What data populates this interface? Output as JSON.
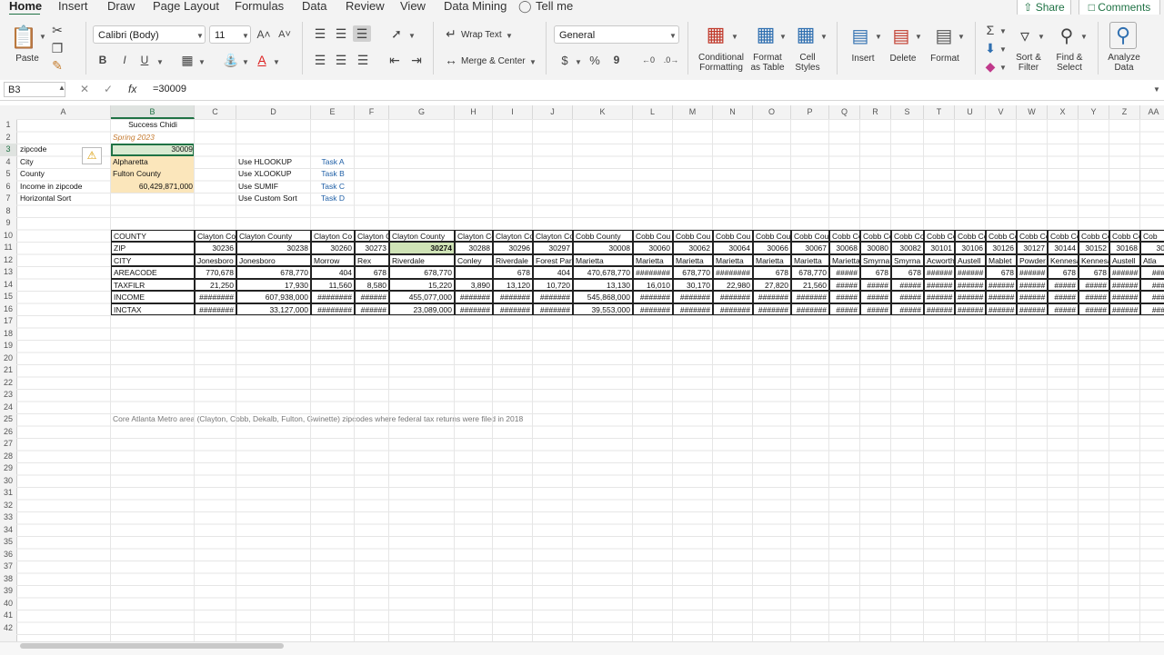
{
  "tabs": [
    "Home",
    "Insert",
    "Draw",
    "Page Layout",
    "Formulas",
    "Data",
    "Review",
    "View",
    "Data Mining",
    "Tell me"
  ],
  "share_label": "Share",
  "comments_label": "Comments",
  "ribbon": {
    "paste": "Paste",
    "font_name": "Calibri (Body)",
    "font_size": "11",
    "bold": "B",
    "italic": "I",
    "underline": "U",
    "wrap_text": "Wrap Text",
    "merge_center": "Merge & Center",
    "number_format": "General",
    "currency": "$",
    "percent": "%",
    "comma": "9",
    "conditional_formatting": [
      "Conditional",
      "Formatting"
    ],
    "format_as_table": [
      "Format",
      "as Table"
    ],
    "cell_styles": [
      "Cell",
      "Styles"
    ],
    "insert": "Insert",
    "delete": "Delete",
    "format": "Format",
    "sort_filter": [
      "Sort &",
      "Filter"
    ],
    "find_select": [
      "Find &",
      "Select"
    ],
    "analyze_data": [
      "Analyze",
      "Data"
    ]
  },
  "formula_bar": {
    "name_box": "B3",
    "formula": "=30009"
  },
  "columns": [
    "A",
    "B",
    "C",
    "D",
    "E",
    "F",
    "G",
    "H",
    "I",
    "J",
    "K",
    "L",
    "M",
    "N",
    "O",
    "P",
    "Q",
    "R",
    "S",
    "T",
    "U",
    "V",
    "W",
    "X",
    "Y",
    "Z",
    "AA"
  ],
  "rows": [
    "1",
    "2",
    "3",
    "4",
    "5",
    "6",
    "7",
    "8",
    "9",
    "10",
    "11",
    "12",
    "13",
    "14",
    "15",
    "16",
    "17",
    "18",
    "19",
    "20",
    "21",
    "22",
    "23",
    "24",
    "25",
    "26",
    "27",
    "28",
    "29",
    "30",
    "31",
    "32",
    "33",
    "34",
    "35",
    "36",
    "37",
    "38",
    "39",
    "40",
    "41",
    "42"
  ],
  "cells": {
    "b1": "Success Chidi",
    "b2": "Spring 2023",
    "a3": "zipcode",
    "b3": "30009",
    "a4": "City",
    "b4": "Alpharetta",
    "a5": "County",
    "b5": "Fulton County",
    "a6": "Income in zipcode",
    "b6": "60,429,871,000",
    "a7": "Horizontal Sort",
    "d4": "Use HLOOKUP",
    "d5": "Use XLOOKUP",
    "d6": "Use SUMIF",
    "d7": "Use Custom Sort",
    "e4": "Task A",
    "e5": "Task B",
    "e6": "Task C",
    "e7": "Task D",
    "note25": "Core Atlanta Metro area (Clayton, Cobb, Dekalb, Fulton, Gwinette) zipcodes where federal tax returns were filed in 2018"
  },
  "table": {
    "labels": [
      "COUNTY",
      "ZIP",
      "CITY",
      "AREACODE",
      "TAXFILR",
      "INCOME",
      "INCTAX"
    ],
    "county": [
      "Clayton Co",
      "Clayton County",
      "Clayton Co",
      "Clayton C",
      "Clayton County",
      "Clayton Co",
      "Clayton Co",
      "Clayton Co",
      "Cobb County",
      "Cobb Cou",
      "Cobb Cou",
      "Cobb Cou",
      "Cobb Cou",
      "Cobb Cou",
      "Cobb Co",
      "Cobb Co",
      "Cobb Co",
      "Cobb Co",
      "Cobb Co",
      "Cobb Co",
      "Cobb Co",
      "Cobb Co",
      "Cobb Co",
      "Cobb Co",
      "Cob"
    ],
    "zip": [
      "30236",
      "30238",
      "30260",
      "30273",
      "30274",
      "30288",
      "30296",
      "30297",
      "30008",
      "30060",
      "30062",
      "30064",
      "30066",
      "30067",
      "30068",
      "30080",
      "30082",
      "30101",
      "30106",
      "30126",
      "30127",
      "30144",
      "30152",
      "30168",
      "30"
    ],
    "city": [
      "Jonesboro",
      "Jonesboro",
      "Morrow",
      "Rex",
      "Riverdale",
      "Conley",
      "Riverdale",
      "Forest Par",
      "Marietta",
      "Marietta",
      "Marietta",
      "Marietta",
      "Marietta",
      "Marietta",
      "Marietta",
      "Smyrna",
      "Smyrna",
      "Acworth",
      "Austell",
      "Mablet",
      "Powder",
      "Kennesa",
      "Kennesa",
      "Austell",
      "Atla"
    ],
    "areacode": [
      "770,678",
      "678,770",
      "404",
      "678",
      "678,770",
      "",
      "678",
      "404",
      "470,678,770",
      "########",
      "678,770",
      "########",
      "678",
      "678,770",
      "#####",
      "678",
      "678",
      "######",
      "######",
      "678",
      "######",
      "678",
      "678",
      "######",
      "###"
    ],
    "taxfilr": [
      "21,250",
      "17,930",
      "11,560",
      "8,580",
      "15,220",
      "3,890",
      "13,120",
      "10,720",
      "13,130",
      "16,010",
      "30,170",
      "22,980",
      "27,820",
      "21,560",
      "#####",
      "#####",
      "#####",
      "######",
      "######",
      "######",
      "######",
      "#####",
      "#####",
      "######",
      "###"
    ],
    "income": [
      "########",
      "607,938,000",
      "########",
      "######",
      "455,077,000",
      "#######",
      "#######",
      "#######",
      "545,868,000",
      "#######",
      "#######",
      "#######",
      "#######",
      "#######",
      "#####",
      "#####",
      "#####",
      "######",
      "######",
      "######",
      "######",
      "#####",
      "#####",
      "######",
      "###"
    ],
    "inctax": [
      "########",
      "33,127,000",
      "########",
      "######",
      "23,089,000",
      "#######",
      "#######",
      "#######",
      "39,553,000",
      "#######",
      "#######",
      "#######",
      "#######",
      "#######",
      "#####",
      "#####",
      "#####",
      "######",
      "######",
      "######",
      "######",
      "#####",
      "#####",
      "######",
      "###"
    ]
  }
}
